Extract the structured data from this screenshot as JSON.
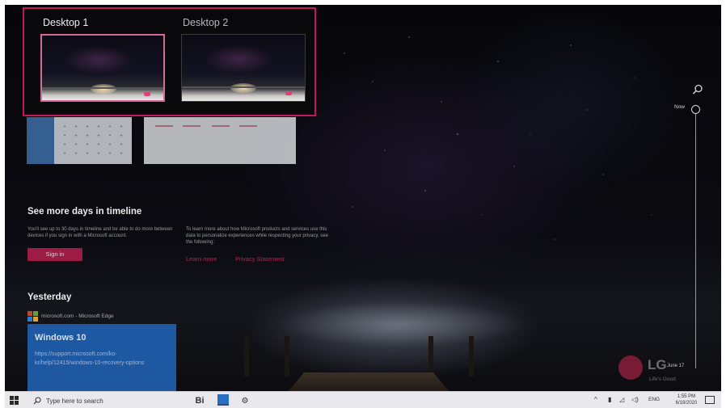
{
  "task_view": {
    "desktops": [
      {
        "label": "Desktop 1",
        "selected": true
      },
      {
        "label": "Desktop 2",
        "selected": false
      }
    ],
    "highlight_color": "#c2185b"
  },
  "timeline": {
    "see_more": {
      "title": "See more days in timeline",
      "description": "You'll see up to 30 days in timeline and be able to do more between devices if you sign in with a Microsoft account.",
      "privacy_text": "To learn more about how Microsoft products and services use this data to personalize experiences while respecting your privacy, see the following:",
      "sign_in_label": "Sign in",
      "learn_more_label": "Learn more",
      "privacy_statement_label": "Privacy Statement"
    },
    "yesterday": {
      "heading": "Yesterday",
      "source": "microsoft.com - Microsoft Edge",
      "card_title": "Windows 10",
      "card_link": "https://support.microsoft.com/ko-kr/help/12415/windows-10-recovery-options"
    },
    "scrubber": {
      "now_label": "Now",
      "date_label": "June 17"
    }
  },
  "watermark": {
    "brand": "LG",
    "slogan": "Life's Good"
  },
  "taskbar": {
    "search_placeholder": "Type here to search",
    "task_view_glyph": "Bi",
    "language": "ENG",
    "time": "1:55 PM",
    "date": "6/19/2020"
  },
  "icons": {
    "start": "windows-logo-icon",
    "search": "search-icon",
    "task_view": "task-view-icon",
    "store": "store-icon",
    "settings": "gear-icon",
    "timeline_search": "search-icon",
    "notifications": "action-center-icon"
  },
  "colors": {
    "accent_pink": "#9d1c46",
    "card_blue": "#1f5fae",
    "taskbar_bg": "#e9e9ed"
  }
}
